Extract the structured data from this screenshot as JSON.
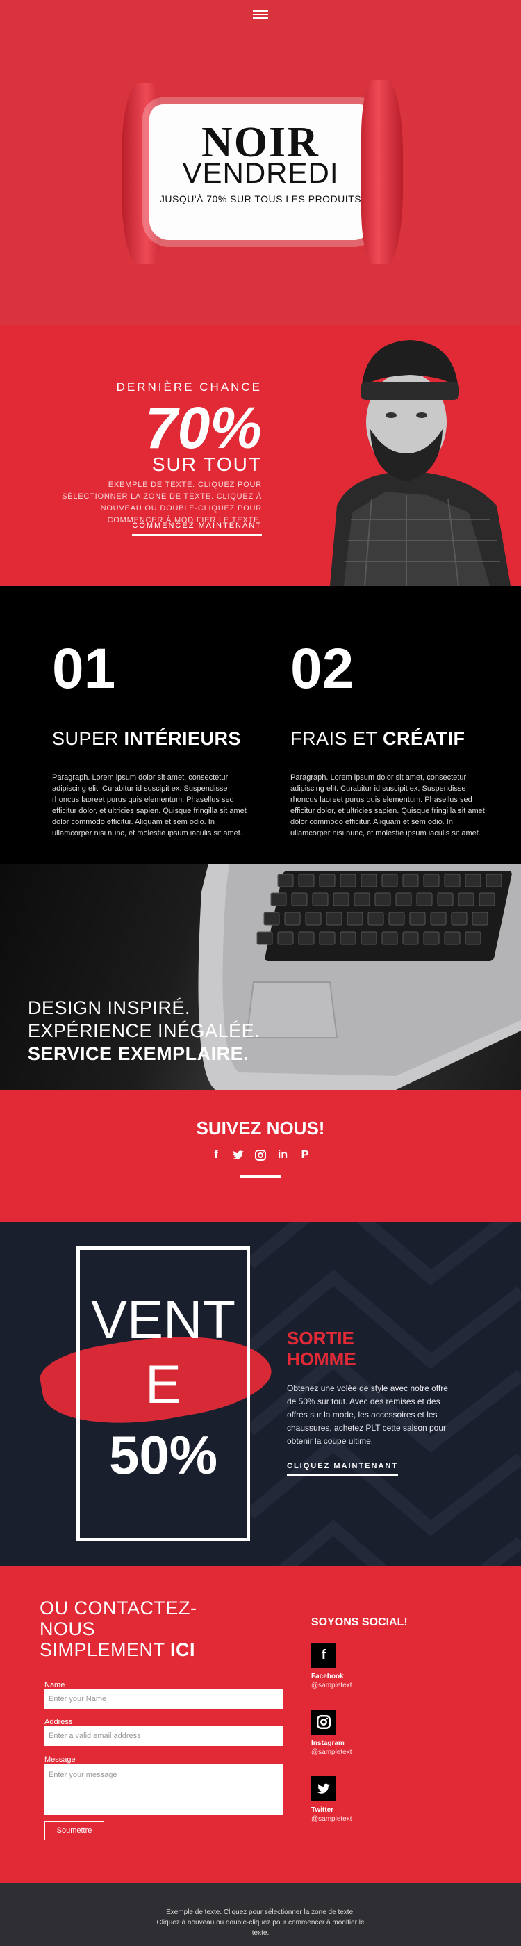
{
  "hero": {
    "title_line1": "NOIR",
    "title_line2": "VENDREDI",
    "subtitle": "JUSQU'À 70% SUR TOUS LES PRODUITS",
    "menu_icon": "hamburger-icon"
  },
  "promo": {
    "kicker": "DERNIÈRE CHANCE",
    "big": "70%",
    "sur": "SUR TOUT",
    "body": "EXEMPLE DE TEXTE. CLIQUEZ POUR SÉLECTIONNER LA ZONE DE TEXTE. CLIQUEZ À NOUVEAU OU DOUBLE-CLIQUEZ POUR COMMENCER À MODIFIER LE TEXTE.",
    "cta": "COMMENCEZ MAINTENANT"
  },
  "features": [
    {
      "num": "01",
      "head_light": "SUPER ",
      "head_bold": "INTÉRIEURS",
      "text": "Paragraph. Lorem ipsum dolor sit amet, consectetur adipiscing elit. Curabitur id suscipit ex. Suspendisse rhoncus laoreet purus quis elementum. Phasellus sed efficitur dolor, et ultricies sapien. Quisque fringilla sit amet dolor commodo efficitur. Aliquam et sem odio. In ullamcorper nisi nunc, et molestie ipsum iaculis sit amet."
    },
    {
      "num": "02",
      "head_light": "FRAIS ET ",
      "head_bold": "CRÉATIF",
      "text": "Paragraph. Lorem ipsum dolor sit amet, consectetur adipiscing elit. Curabitur id suscipit ex. Suspendisse rhoncus laoreet purus quis elementum. Phasellus sed efficitur dolor, et ultricies sapien. Quisque fringilla sit amet dolor commodo efficitur. Aliquam et sem odio. In ullamcorper nisi nunc, et molestie ipsum iaculis sit amet."
    }
  ],
  "banner": {
    "line1": "DESIGN INSPIRÉ.",
    "line2": "EXPÉRIENCE INÉGALÉE.",
    "line3": "SERVICE EXEMPLAIRE."
  },
  "follow": {
    "title": "SUIVEZ NOUS!",
    "icons": [
      "facebook-icon",
      "twitter-icon",
      "instagram-icon",
      "linkedin-icon",
      "pinterest-icon"
    ]
  },
  "sale": {
    "v1": "VENT",
    "v2": "E",
    "v3": "50%",
    "title_line1": "SORTIE",
    "title_line2": "HOMME",
    "text": "Obtenez une volée de style avec notre offre de 50% sur tout. Avec des remises et des offres sur la mode, les accessoires et les chaussures, achetez PLT cette saison pour obtenir la coupe ultime.",
    "cta": "CLIQUEZ MAINTENANT"
  },
  "contact": {
    "heading_line1": "OU CONTACTEZ-",
    "heading_line2": "NOUS",
    "heading_line3": "SIMPLEMENT ",
    "heading_bold": "ICI",
    "name_label": "Name",
    "name_placeholder": "Enter your Name",
    "address_label": "Address",
    "address_placeholder": "Enter a valid email address",
    "message_label": "Message",
    "message_placeholder": "Enter your message",
    "submit": "Soumettre",
    "social_title": "SOYONS SOCIAL!",
    "social": [
      {
        "name": "Facebook",
        "handle": "@sampletext",
        "icon": "facebook-icon"
      },
      {
        "name": "Instagram",
        "handle": "@sampletext",
        "icon": "instagram-icon"
      },
      {
        "name": "Twitter",
        "handle": "@sampletext",
        "icon": "twitter-icon"
      }
    ]
  },
  "footer": {
    "text": "Exemple de texte. Cliquez pour sélectionner la zone de texte. Cliquez à nouveau ou double-cliquez pour commencer à modifier le texte."
  },
  "colors": {
    "brand_red": "#e22a37",
    "dark": "#1a1f2e",
    "black": "#000000",
    "footer": "#2f2f33"
  }
}
